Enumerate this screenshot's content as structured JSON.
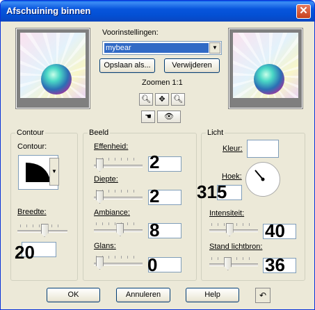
{
  "window": {
    "title": "Afschuining binnen",
    "close_glyph": "✕"
  },
  "presets": {
    "label": "Voorinstellingen:",
    "selected": "mybear",
    "save_button": "Opslaan als...",
    "delete_button": "Verwijderen",
    "zoom_label": "Zoomen 1:1"
  },
  "contour_group": {
    "title": "Contour",
    "contour_label": "Contour:",
    "breedte_label": "Breedte:",
    "breedte_value": "20"
  },
  "beeld_group": {
    "title": "Beeld",
    "effenheid_label": "Effenheid:",
    "effenheid_value": "2",
    "diepte_label": "Diepte:",
    "diepte_value": "2",
    "ambiance_label": "Ambiance:",
    "ambiance_value": "8",
    "glans_label": "Glans:",
    "glans_value": "0"
  },
  "licht_group": {
    "title": "Licht",
    "kleur_label": "Kleur:",
    "hoek_label": "Hoek:",
    "hoek_value": "315",
    "intensiteit_label": "Intensiteit:",
    "intensiteit_value": "40",
    "stand_label": "Stand lichtbron:",
    "stand_value": "36"
  },
  "footer": {
    "ok": "OK",
    "cancel": "Annuleren",
    "help": "Help"
  },
  "sliders": {
    "effenheid": 0.05,
    "diepte": 0.05,
    "ambiance": 0.55,
    "glans": 0.05,
    "breedte": 0.55,
    "intensiteit": 0.4,
    "stand": 0.36
  },
  "colors": {
    "title_bar": "#0855dd",
    "selection": "#316ac5",
    "window_bg": "#ece9d8"
  }
}
